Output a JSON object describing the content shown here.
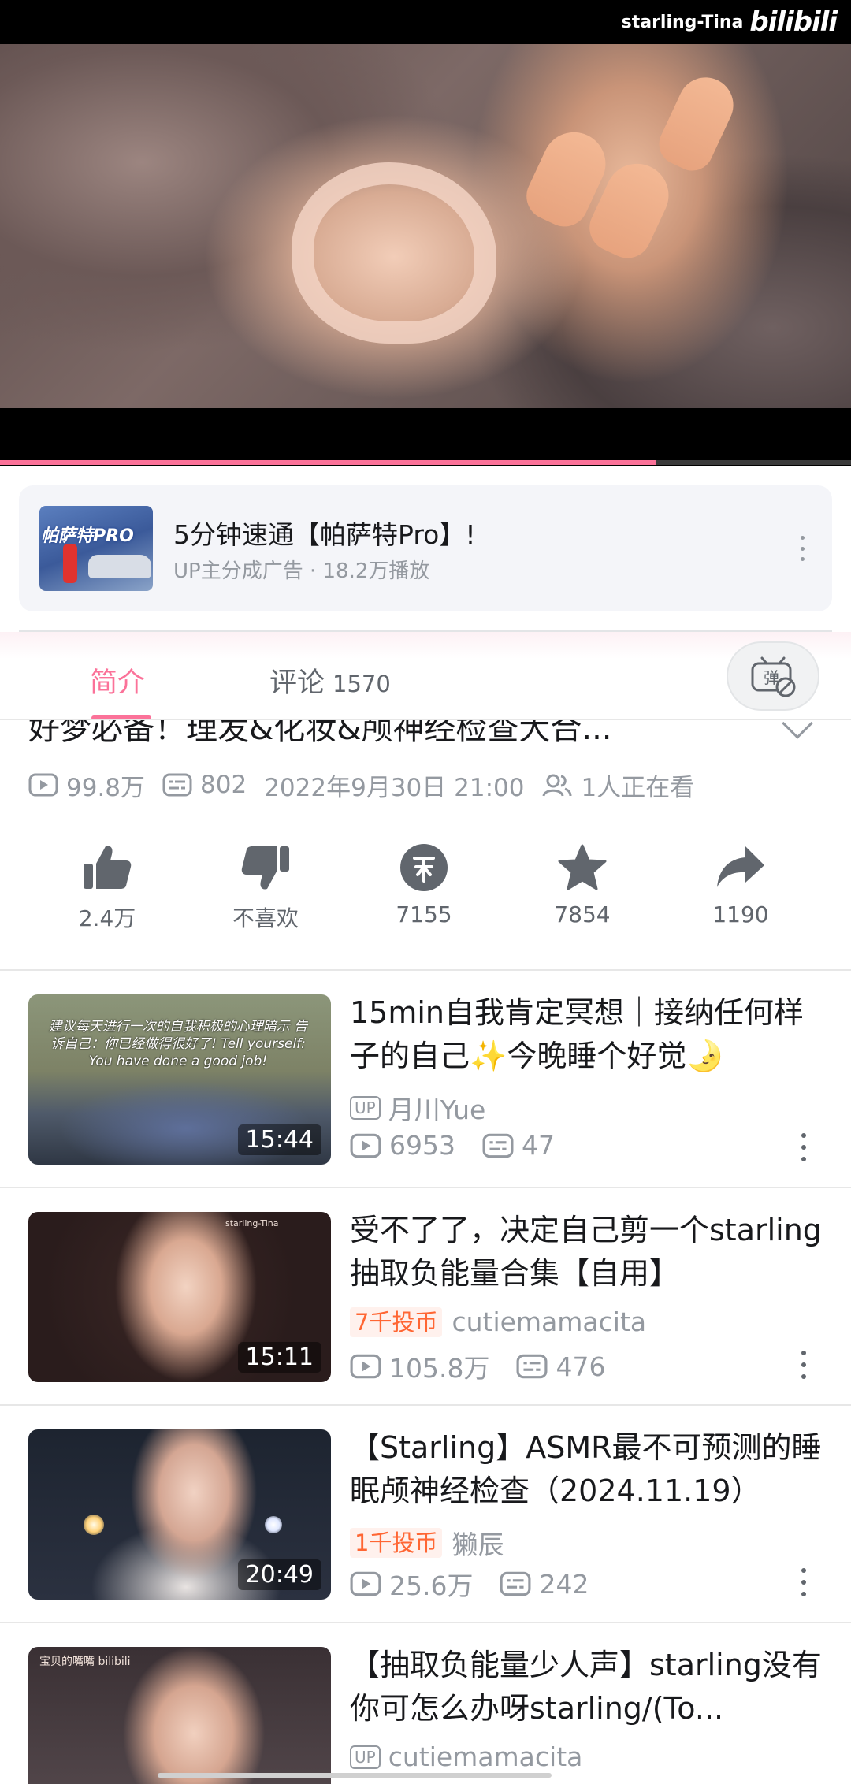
{
  "player": {
    "watermark_user": "starling-Tina",
    "watermark_logo": "bilibili",
    "progress_percent": 77
  },
  "ad": {
    "thumb_text": "帕萨特PRO",
    "title": "5分钟速通【帕萨特Pro】!",
    "subtitle": "UP主分成广告 · 18.2万播放"
  },
  "tabs": {
    "intro": "简介",
    "comments": "评论",
    "comments_count": "1570",
    "danmaku_icon": "danmaku-off-icon"
  },
  "video": {
    "title": "好梦必备！理发&化妆&颅神经检查大合...",
    "views": "99.8万",
    "danmaku_count": "802",
    "datetime": "2022年9月30日 21:00",
    "watching": "1人正在看"
  },
  "actions": [
    {
      "icon": "thumbs-up-icon",
      "label": "2.4万"
    },
    {
      "icon": "thumbs-down-icon",
      "label": "不喜欢"
    },
    {
      "icon": "coin-icon",
      "label": "7155"
    },
    {
      "icon": "star-icon",
      "label": "7854"
    },
    {
      "icon": "share-icon",
      "label": "1190"
    }
  ],
  "recommendations": [
    {
      "title": "15min自我肯定冥想｜接纳任何样子的自己✨今晚睡个好觉🌛",
      "owner": "月川Yue",
      "badge": "UP",
      "coin_badge": "",
      "views": "6953",
      "danmaku": "47",
      "duration": "15:44",
      "thumb_text": "建议每天进行一次的自我积极的心理暗示 告诉自己：你已经做得很好了! Tell yourself: You have done a good job!"
    },
    {
      "title": "受不了了，决定自己剪一个starling抽取负能量合集【自用】",
      "owner": "cutiemamacita",
      "badge": "",
      "coin_badge": "7千投币",
      "views": "105.8万",
      "danmaku": "476",
      "duration": "15:11",
      "thumb_text": "starling-Tina"
    },
    {
      "title": "【Starling】ASMR最不可预测的睡眠颅神经检查（2024.11.19）",
      "owner": "獭辰",
      "badge": "",
      "coin_badge": "1千投币",
      "views": "25.6万",
      "danmaku": "242",
      "duration": "20:49",
      "thumb_text": ""
    },
    {
      "title": "【抽取负能量少人声】starling没有你可怎么办呀starling/(To...",
      "owner": "cutiemamacita",
      "badge": "UP",
      "coin_badge": "",
      "views": "",
      "danmaku": "",
      "duration": "",
      "thumb_text": "宝贝的嘴嘴 bilibili"
    }
  ],
  "colors": {
    "accent": "#fb7299",
    "coin_badge_text": "#ff6633",
    "muted": "#9499a0"
  }
}
